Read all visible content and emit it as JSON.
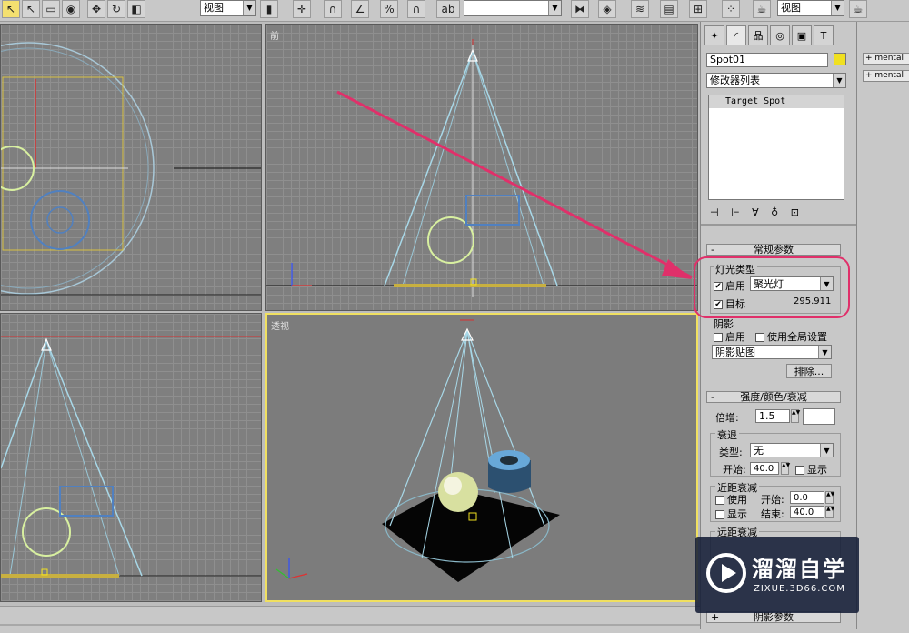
{
  "toolbar": {
    "view_select_1": "视图",
    "view_select_2": "视图",
    "icons": [
      "select-arrow-icon",
      "select-cursor-icon",
      "select-region-icon",
      "select-circle-icon",
      "move-icon",
      "rotate-icon",
      "scale-icon",
      "view-dropdown",
      "pivot-icon",
      "manipulate-icon",
      "snap-icon",
      "angle-snap-icon",
      "percent-snap-icon",
      "spinner-snap-icon",
      "named-selection-icon",
      "mirror-icon",
      "align-icon",
      "layers-icon",
      "curve-editor-icon",
      "schematic-icon",
      "material-editor-icon",
      "render-scene-icon",
      "render-teapot-icon"
    ]
  },
  "viewports": {
    "top_right_label": "前",
    "bottom_right_label": "透视"
  },
  "command_panel": {
    "object_name": "Spot01",
    "object_color": "#f0e020",
    "modifier_list": "修改器列表",
    "modifier_stack_item": "Target Spot",
    "general_params": {
      "title": "常规参数",
      "light_type_group": "灯光类型",
      "on_label": "启用",
      "on_checked": true,
      "light_type_value": "聚光灯",
      "target_label": "目标",
      "target_checked": true,
      "target_distance": "295.911",
      "shadow_group": "阴影",
      "shadow_on_label": "启用",
      "shadow_on_checked": false,
      "use_global_label": "使用全局设置",
      "use_global_checked": false,
      "shadow_type": "阴影贴图",
      "exclude_button": "排除..."
    },
    "intensity": {
      "title": "强度/颜色/衰减",
      "multiplier_label": "倍增:",
      "multiplier_value": "1.5",
      "multiplier_color": "#ffffff",
      "decay_group": "衰退",
      "type_label": "类型:",
      "type_value": "无",
      "start_label": "开始:",
      "start_value": "40.0",
      "show_label": "显示",
      "near_group": "近距衰减",
      "near_use_label": "使用",
      "near_start_label": "开始:",
      "near_start_value": "0.0",
      "near_show_label": "显示",
      "near_end_label": "结束:",
      "near_end_value": "40.0",
      "far_group": "远距衰减"
    },
    "bottom_rollout": "阴影参数"
  },
  "right_panel": {
    "items": [
      "+ mental",
      "+ mental"
    ]
  },
  "watermark": {
    "title": "溜溜自学",
    "url": "ZIXUE.3D66.COM"
  }
}
